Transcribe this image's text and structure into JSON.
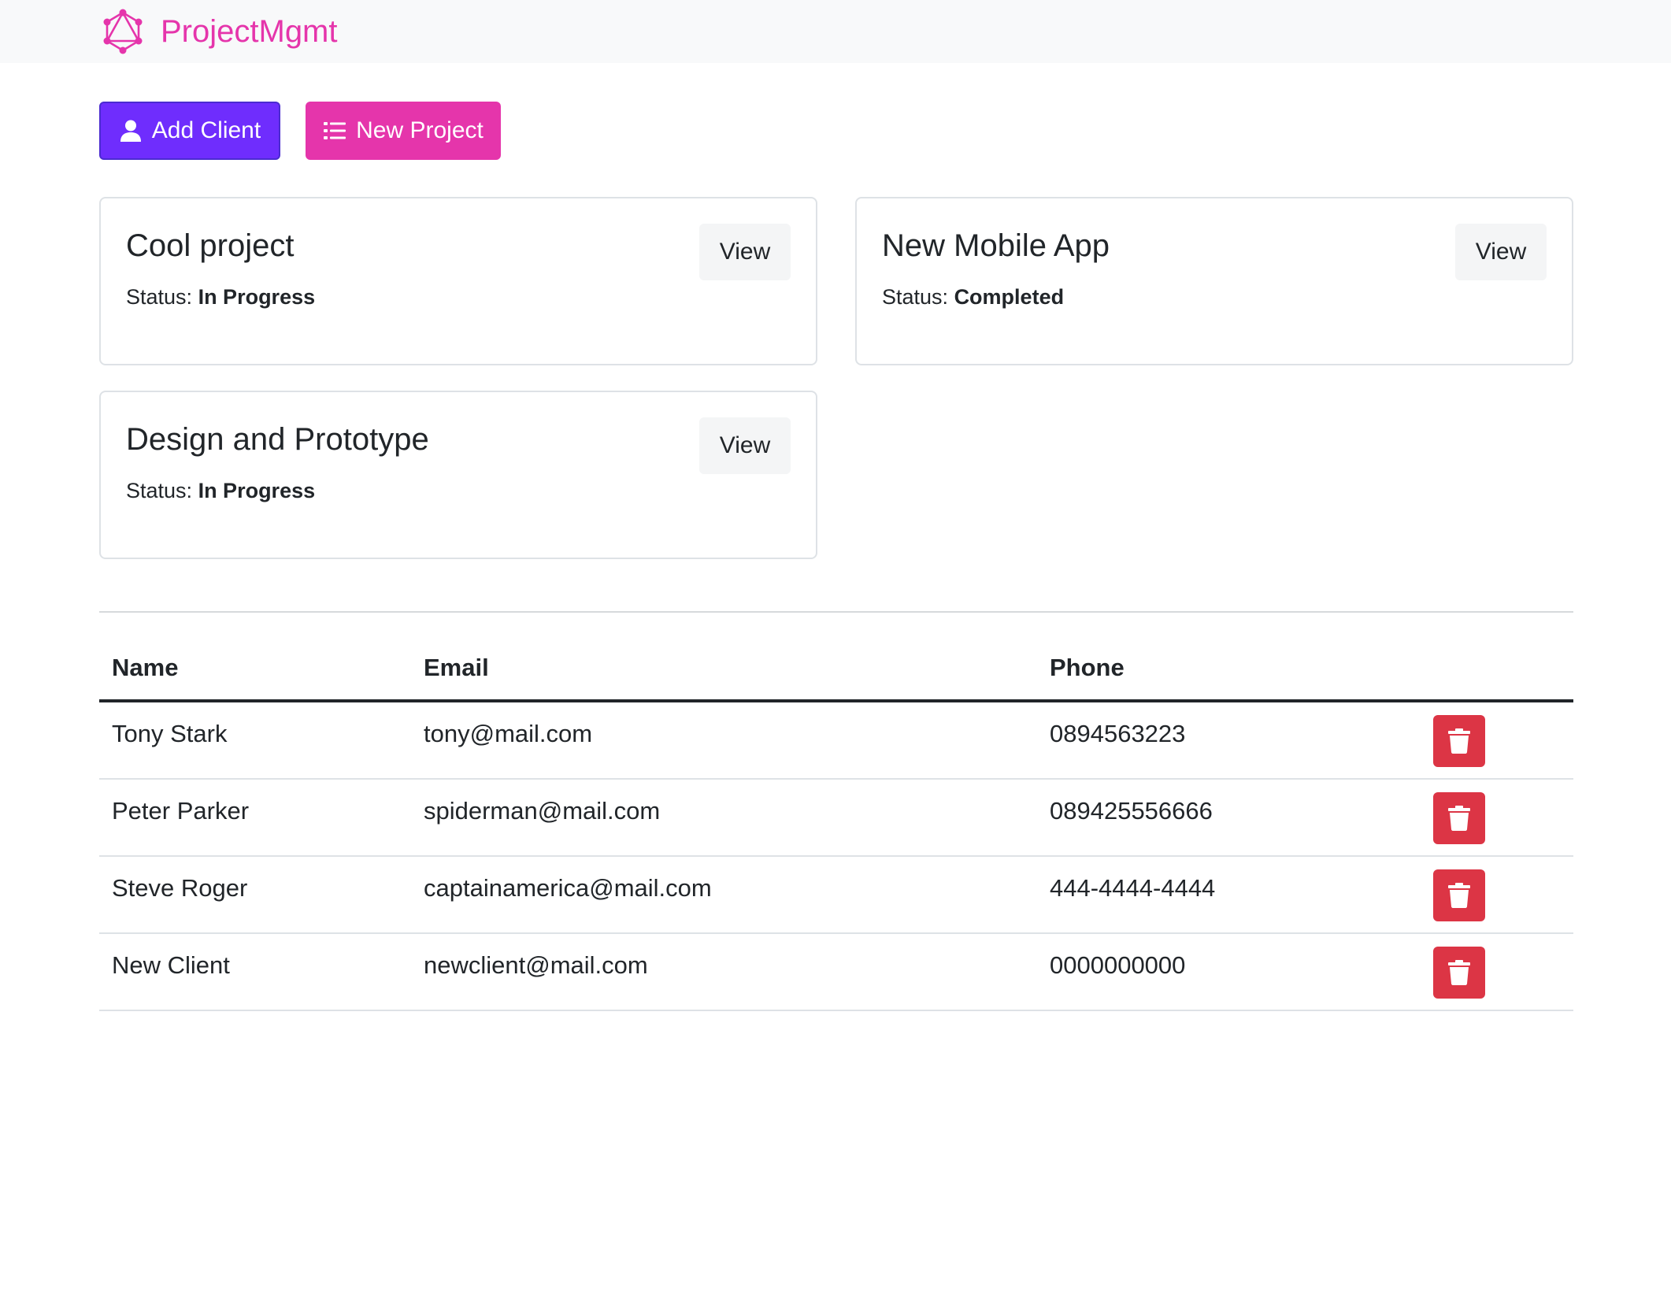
{
  "header": {
    "brand": "ProjectMgmt",
    "brand_color": "#e535ab",
    "logo_icon": "graphql-logo-icon"
  },
  "actions": {
    "add_client_label": "Add Client",
    "add_client_icon": "user-icon",
    "new_project_label": "New Project",
    "new_project_icon": "list-icon"
  },
  "projects": [
    {
      "name": "Cool project",
      "status_label": "Status:",
      "status": "In Progress",
      "view_label": "View"
    },
    {
      "name": "New Mobile App",
      "status_label": "Status:",
      "status": "Completed",
      "view_label": "View"
    },
    {
      "name": "Design and Prototype",
      "status_label": "Status:",
      "status": "In Progress",
      "view_label": "View"
    }
  ],
  "clients": {
    "columns": [
      "Name",
      "Email",
      "Phone"
    ],
    "rows": [
      {
        "name": "Tony Stark",
        "email": "tony@mail.com",
        "phone": "0894563223"
      },
      {
        "name": "Peter Parker",
        "email": "spiderman@mail.com",
        "phone": "089425556666"
      },
      {
        "name": "Steve Roger",
        "email": "captainamerica@mail.com",
        "phone": "444-4444-4444"
      },
      {
        "name": "New Client",
        "email": "newclient@mail.com",
        "phone": "0000000000"
      }
    ],
    "delete_icon": "trash-icon",
    "delete_color": "#dc3545"
  }
}
